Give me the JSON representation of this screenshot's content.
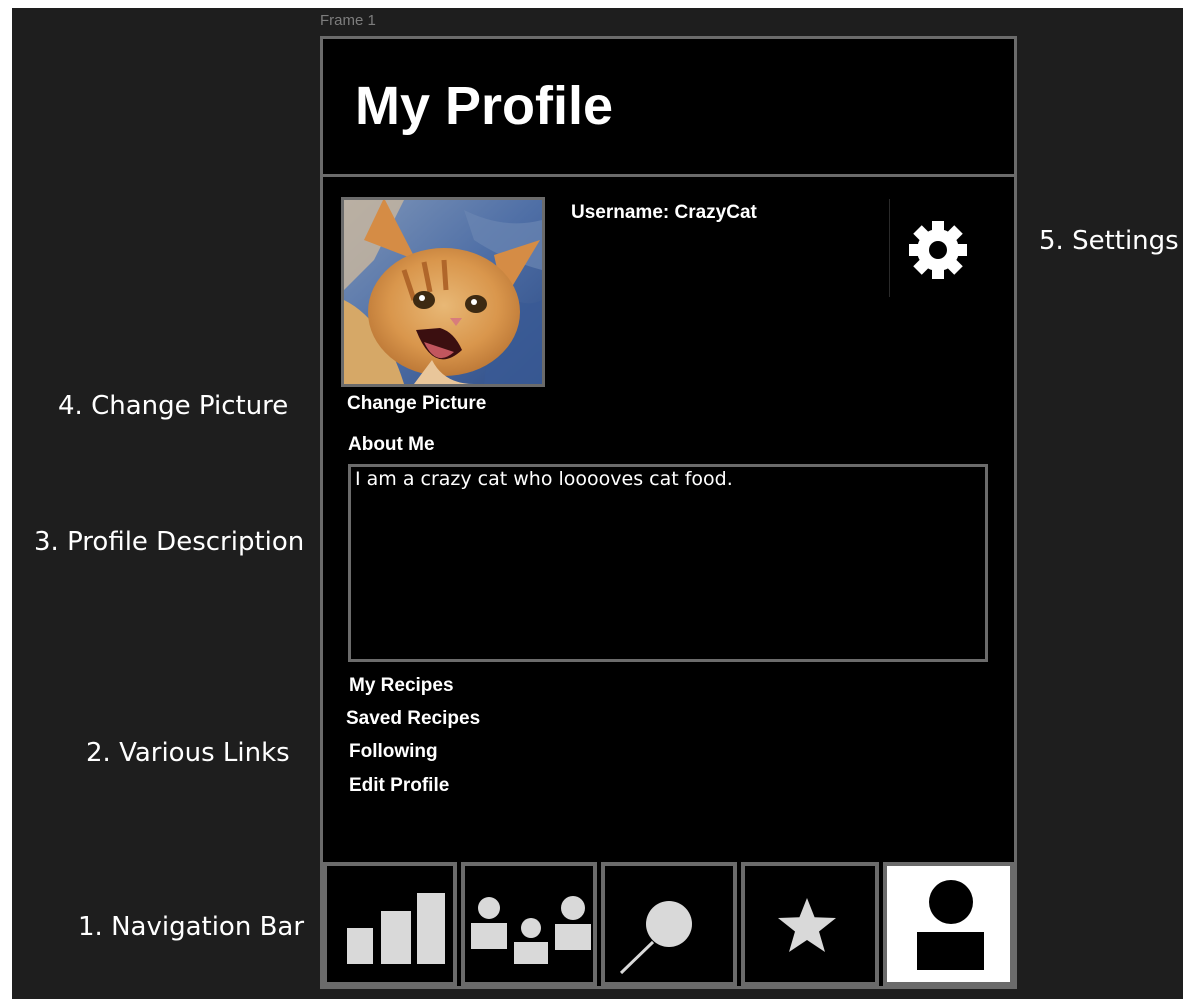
{
  "frame": {
    "label": "Frame 1"
  },
  "annotations": {
    "settings": "5. Settings",
    "change_picture": "4. Change Picture",
    "profile_description": "3. Profile Description",
    "various_links": "2. Various Links",
    "navigation_bar": "1. Navigation Bar"
  },
  "header": {
    "title": "My Profile"
  },
  "profile": {
    "username": "Username: CrazyCat",
    "change_picture_label": "Change Picture",
    "about_label": "About Me",
    "about_text": "I am a crazy cat who looooves cat food."
  },
  "links": [
    "My Recipes",
    "Saved Recipes",
    "Following",
    "Edit Profile"
  ],
  "settings": {
    "icon": "gear-icon"
  },
  "nav": {
    "items": [
      {
        "icon": "bar-chart-icon",
        "active": false
      },
      {
        "icon": "people-icon",
        "active": false
      },
      {
        "icon": "search-icon",
        "active": false
      },
      {
        "icon": "star-icon",
        "active": false
      },
      {
        "icon": "profile-icon",
        "active": true
      }
    ]
  },
  "colors": {
    "canvas": "#1e1e1e",
    "frame_bg": "#000000",
    "border": "#6b6b6b",
    "icon_fill": "#d9d9d9",
    "active_nav_bg": "#ffffff"
  }
}
